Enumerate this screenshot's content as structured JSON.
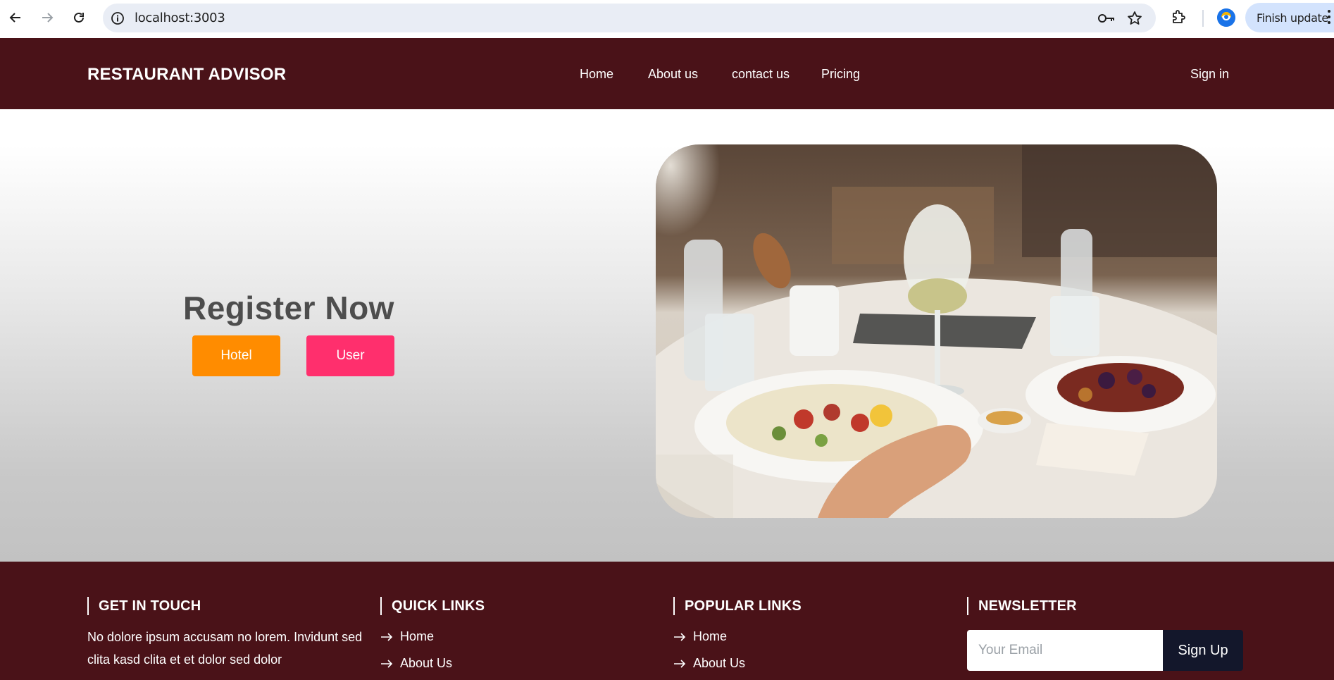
{
  "browser": {
    "url": "localhost:3003",
    "update_label": "Finish update",
    "icons": [
      "back-arrow-icon",
      "forward-arrow-icon",
      "reload-icon",
      "site-info-icon",
      "password-key-icon",
      "bookmark-star-icon",
      "extensions-puzzle-icon",
      "profile-avatar-icon",
      "more-menu-icon"
    ]
  },
  "header": {
    "brand": "RESTAURANT ADVISOR",
    "nav": [
      "Home",
      "About us",
      "contact us",
      "Pricing"
    ],
    "signin": "Sign in"
  },
  "hero": {
    "title": "Register Now",
    "buttons": {
      "hotel": "Hotel",
      "user": "User"
    },
    "image": "restaurant-table-meal-photo"
  },
  "footer": {
    "contact": {
      "heading": "GET IN TOUCH",
      "text": "No dolore ipsum accusam no lorem. Invidunt sed clita kasd clita et et dolor sed dolor"
    },
    "quick_links": {
      "heading": "QUICK LINKS",
      "items": [
        "Home",
        "About Us"
      ]
    },
    "popular_links": {
      "heading": "POPULAR LINKS",
      "items": [
        "Home",
        "About Us"
      ]
    },
    "newsletter": {
      "heading": "NEWSLETTER",
      "placeholder": "Your Email",
      "button": "Sign Up"
    }
  },
  "colors": {
    "header_bg": "#4a1218",
    "hotel_button": "#ff8c00",
    "user_button": "#ff2f6d",
    "signup_button": "#13172b"
  }
}
